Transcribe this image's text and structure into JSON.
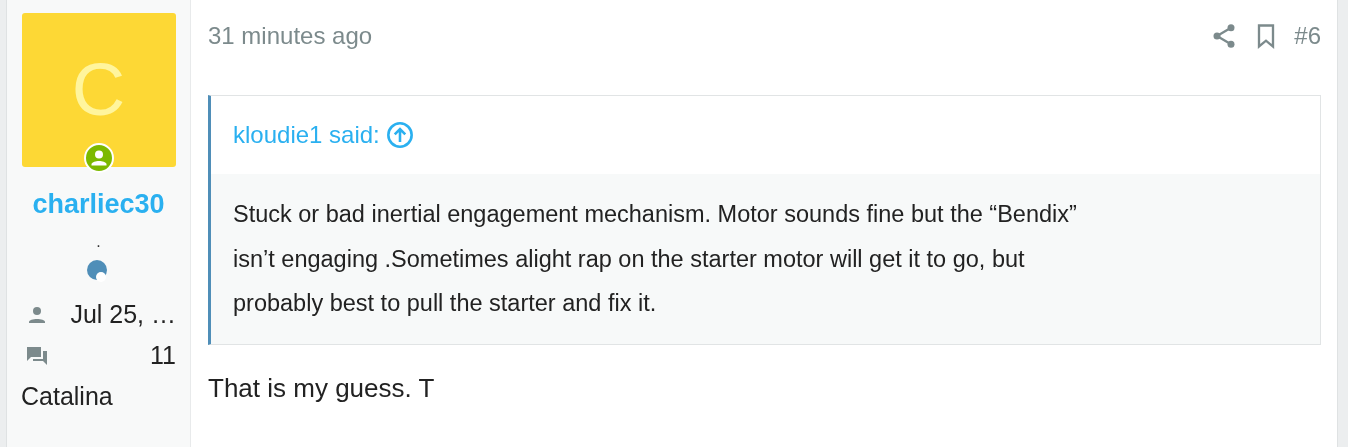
{
  "user": {
    "avatar_letter": "C",
    "username": "charliec30",
    "user_title": ".",
    "joined": "Jul 25, …",
    "messages": "11",
    "location": "Catalina"
  },
  "post": {
    "time": "31 minutes ago",
    "post_number": "#6",
    "quote": {
      "attribution": "kloudie1 said:",
      "text": "Stuck or bad inertial engagement mechanism. Motor sounds fine but the “Bendix” isn’t engaging .Sometimes alight rap on the starter motor will get it to go, but probably best to pull the starter and fix it."
    },
    "body": "That is my guess. T"
  }
}
